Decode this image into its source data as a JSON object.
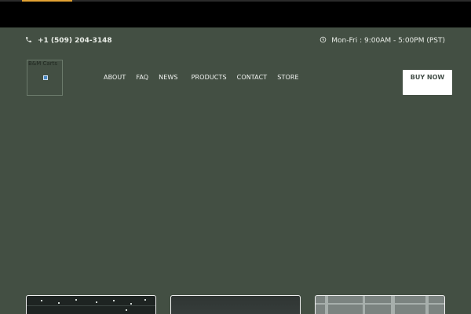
{
  "topbar": {
    "phone": "+1 (509) 204-3148",
    "hours": "Mon-Fri : 9:00AM - 5:00PM (PST)"
  },
  "logo": {
    "text": "B&M Carts"
  },
  "nav": {
    "items": [
      "ABOUT",
      "FAQ",
      "NEWS",
      "PRODUCTS",
      "CONTACT",
      "STORE"
    ]
  },
  "cta": {
    "label": "BUY NOW"
  },
  "icons": {
    "phone": "phone-icon",
    "clock": "clock-icon"
  },
  "colors": {
    "background": "#434f43",
    "top_strip": "#000000",
    "accent": "#e2a233",
    "text": "#e8ece6",
    "button_bg": "#ffffff"
  }
}
